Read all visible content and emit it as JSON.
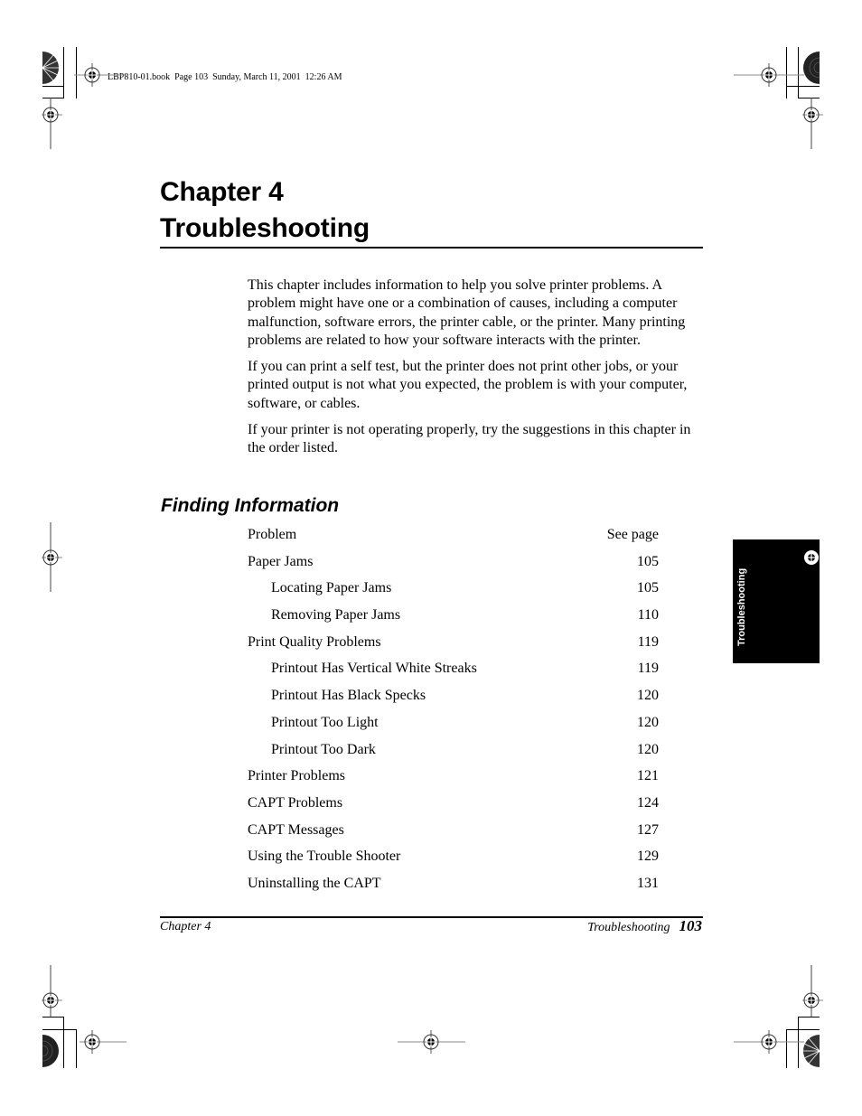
{
  "slug": "LBP810-01.book  Page 103  Sunday, March 11, 2001  12:26 AM",
  "chapter": {
    "line1": "Chapter 4",
    "line2": "Troubleshooting"
  },
  "intro": [
    "This chapter includes information to help you solve printer problems. A problem might have one or a combination of causes, including a computer malfunction, software errors, the printer cable, or the printer. Many printing problems are related to how your software interacts with the printer.",
    "If you can print a self test, but the printer does not print other jobs, or your printed output is not what you expected, the problem is with your computer, software, or cables.",
    "If your printer is not operating properly, try the suggestions in this chapter in the order listed."
  ],
  "section": {
    "heading": "Finding Information",
    "table": {
      "headers": {
        "problem": "Problem",
        "page": "See page"
      },
      "rows": [
        {
          "label": "Paper Jams",
          "page": "105",
          "level": 0
        },
        {
          "label": "Locating Paper Jams",
          "page": "105",
          "level": 1
        },
        {
          "label": "Removing Paper Jams",
          "page": "110",
          "level": 1
        },
        {
          "label": "Print Quality Problems",
          "page": "119",
          "level": 0
        },
        {
          "label": "Printout Has Vertical White Streaks",
          "page": "119",
          "level": 1
        },
        {
          "label": "Printout Has Black Specks",
          "page": "120",
          "level": 1
        },
        {
          "label": "Printout Too Light",
          "page": "120",
          "level": 1
        },
        {
          "label": "Printout Too Dark",
          "page": "120",
          "level": 1
        },
        {
          "label": "Printer Problems",
          "page": "121",
          "level": 0
        },
        {
          "label": "CAPT Problems",
          "page": "124",
          "level": 0
        },
        {
          "label": "CAPT Messages",
          "page": "127",
          "level": 0
        },
        {
          "label": "Using the Trouble Shooter",
          "page": "129",
          "level": 0
        },
        {
          "label": "Uninstalling the CAPT",
          "page": "131",
          "level": 0
        }
      ]
    }
  },
  "thumb_tab": {
    "label": "Troubleshooting",
    "icon": "registration-mark-icon"
  },
  "footer": {
    "left": "Chapter 4",
    "right": "Troubleshooting",
    "page_number": "103"
  },
  "icons": {
    "registration_mark": "registration-mark-icon",
    "crop_mark": "crop-mark-icon",
    "color_wheel": "star-target-icon"
  }
}
